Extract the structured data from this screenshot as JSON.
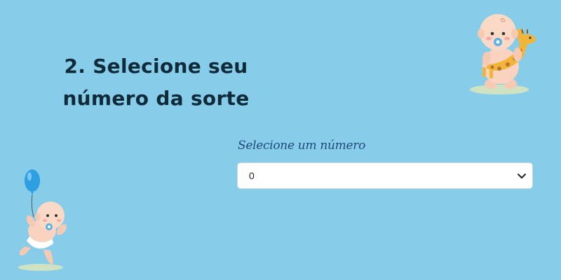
{
  "section": {
    "title_line1": "2. Selecione seu",
    "title_line2": "número da sorte"
  },
  "number_select": {
    "label": "Selecione um número",
    "value": "0",
    "icon": "chevron-down-icon"
  },
  "decorations": {
    "top_right": "baby-with-giraffe-illustration",
    "bottom_left": "baby-with-balloon-illustration"
  },
  "colors": {
    "background": "#87CDEA",
    "heading": "#0f2b3a",
    "label": "#1f4a7a"
  }
}
